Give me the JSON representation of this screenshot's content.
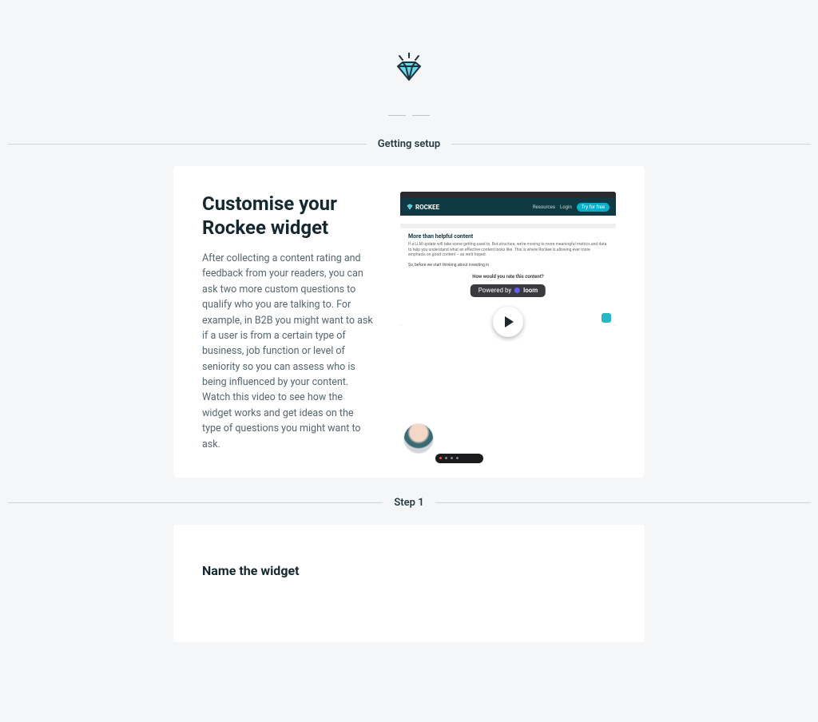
{
  "header": {
    "section_label": "Getting setup"
  },
  "intro_card": {
    "title": "Customise your Rockee widget",
    "body": "After collecting a content rating and feedback from your readers, you can ask two more custom questions to qualify who you are talking to. For example, in B2B you might want to ask if a user is from a certain type of business, job function or level of seniority so you can assess who is being influenced by your content. Watch this video to see how the widget works and get ideas on the type of questions you might want to ask."
  },
  "video": {
    "brand": "ROCKEE",
    "nav_resources": "Resources",
    "nav_login": "Login",
    "nav_cta": "Try for free",
    "content_heading": "More than helpful content",
    "content_blurb": "If a LLM update will take some getting used to. But structure, we're moving to more meaningful metrics and data to help you understand what an effective content looks like. This is where Rockee is allowing ever more emphasis on good content – as we'd hoped.",
    "content_line2": "So, before we start thinking about investing in",
    "rate_prompt": "How would you rate this content?",
    "powered_label": "Powered by",
    "powered_brand": "loom"
  },
  "step1": {
    "label": "Step 1",
    "heading": "Name the widget"
  }
}
